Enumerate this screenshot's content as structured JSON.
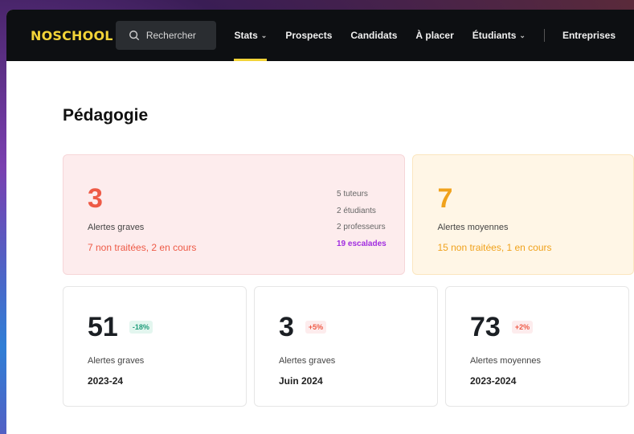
{
  "app": {
    "logo": "NOSCHOOL"
  },
  "search": {
    "label": "Rechercher"
  },
  "nav": {
    "items": [
      {
        "label": "Stats",
        "dropdown": true,
        "active": true
      },
      {
        "label": "Prospects"
      },
      {
        "label": "Candidats"
      },
      {
        "label": "À placer"
      },
      {
        "label": "Étudiants",
        "dropdown": true
      },
      {
        "label": "Entreprises"
      }
    ]
  },
  "page": {
    "title": "Pédagogie"
  },
  "alerts": {
    "grave": {
      "count": "3",
      "label": "Alertes graves",
      "status": "7 non traitées, 2 en cours",
      "breakdown": [
        "5 tuteurs",
        "2 étudiants",
        "2 professeurs"
      ],
      "escalades": "19 escalades"
    },
    "moyenne": {
      "count": "7",
      "label": "Alertes moyennes",
      "status": "15 non traitées, 1 en cours"
    }
  },
  "stats": [
    {
      "value": "51",
      "delta": "-18%",
      "trend": "down",
      "label": "Alertes graves",
      "period": "2023-24"
    },
    {
      "value": "3",
      "delta": "+5%",
      "trend": "up",
      "label": "Alertes graves",
      "period": "Juin 2024"
    },
    {
      "value": "73",
      "delta": "+2%",
      "trend": "up",
      "label": "Alertes moyennes",
      "period": "2023-2024"
    }
  ],
  "colors": {
    "accent": "#f2d338",
    "grave": "#ee5a46",
    "moyenne": "#f0a21c",
    "escalade": "#a12ee0",
    "positive": "#1e9c7a"
  }
}
